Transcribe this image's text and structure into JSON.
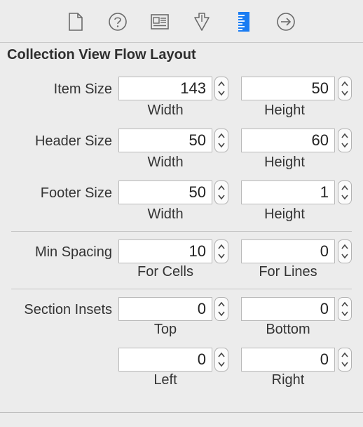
{
  "inspector_tabs": [
    {
      "icon": "file-icon"
    },
    {
      "icon": "help-icon"
    },
    {
      "icon": "identity-icon"
    },
    {
      "icon": "attributes-icon"
    },
    {
      "icon": "size-ruler-icon",
      "active": true
    },
    {
      "icon": "connections-icon"
    }
  ],
  "colors": {
    "active_tab": "#1a7cf2",
    "inactive_tab": "#6a6a6a"
  },
  "section_title": "Collection View Flow Layout",
  "item_size": {
    "label": "Item Size",
    "width_value": "143",
    "height_value": "50",
    "width_caption": "Width",
    "height_caption": "Height"
  },
  "header_size": {
    "label": "Header Size",
    "width_value": "50",
    "height_value": "60",
    "width_caption": "Width",
    "height_caption": "Height"
  },
  "footer_size": {
    "label": "Footer Size",
    "width_value": "50",
    "height_value": "1",
    "width_caption": "Width",
    "height_caption": "Height"
  },
  "min_spacing": {
    "label": "Min Spacing",
    "cells_value": "10",
    "lines_value": "0",
    "cells_caption": "For Cells",
    "lines_caption": "For Lines"
  },
  "section_insets": {
    "label": "Section Insets",
    "top_value": "0",
    "bottom_value": "0",
    "left_value": "0",
    "right_value": "0",
    "top_caption": "Top",
    "bottom_caption": "Bottom",
    "left_caption": "Left",
    "right_caption": "Right"
  }
}
